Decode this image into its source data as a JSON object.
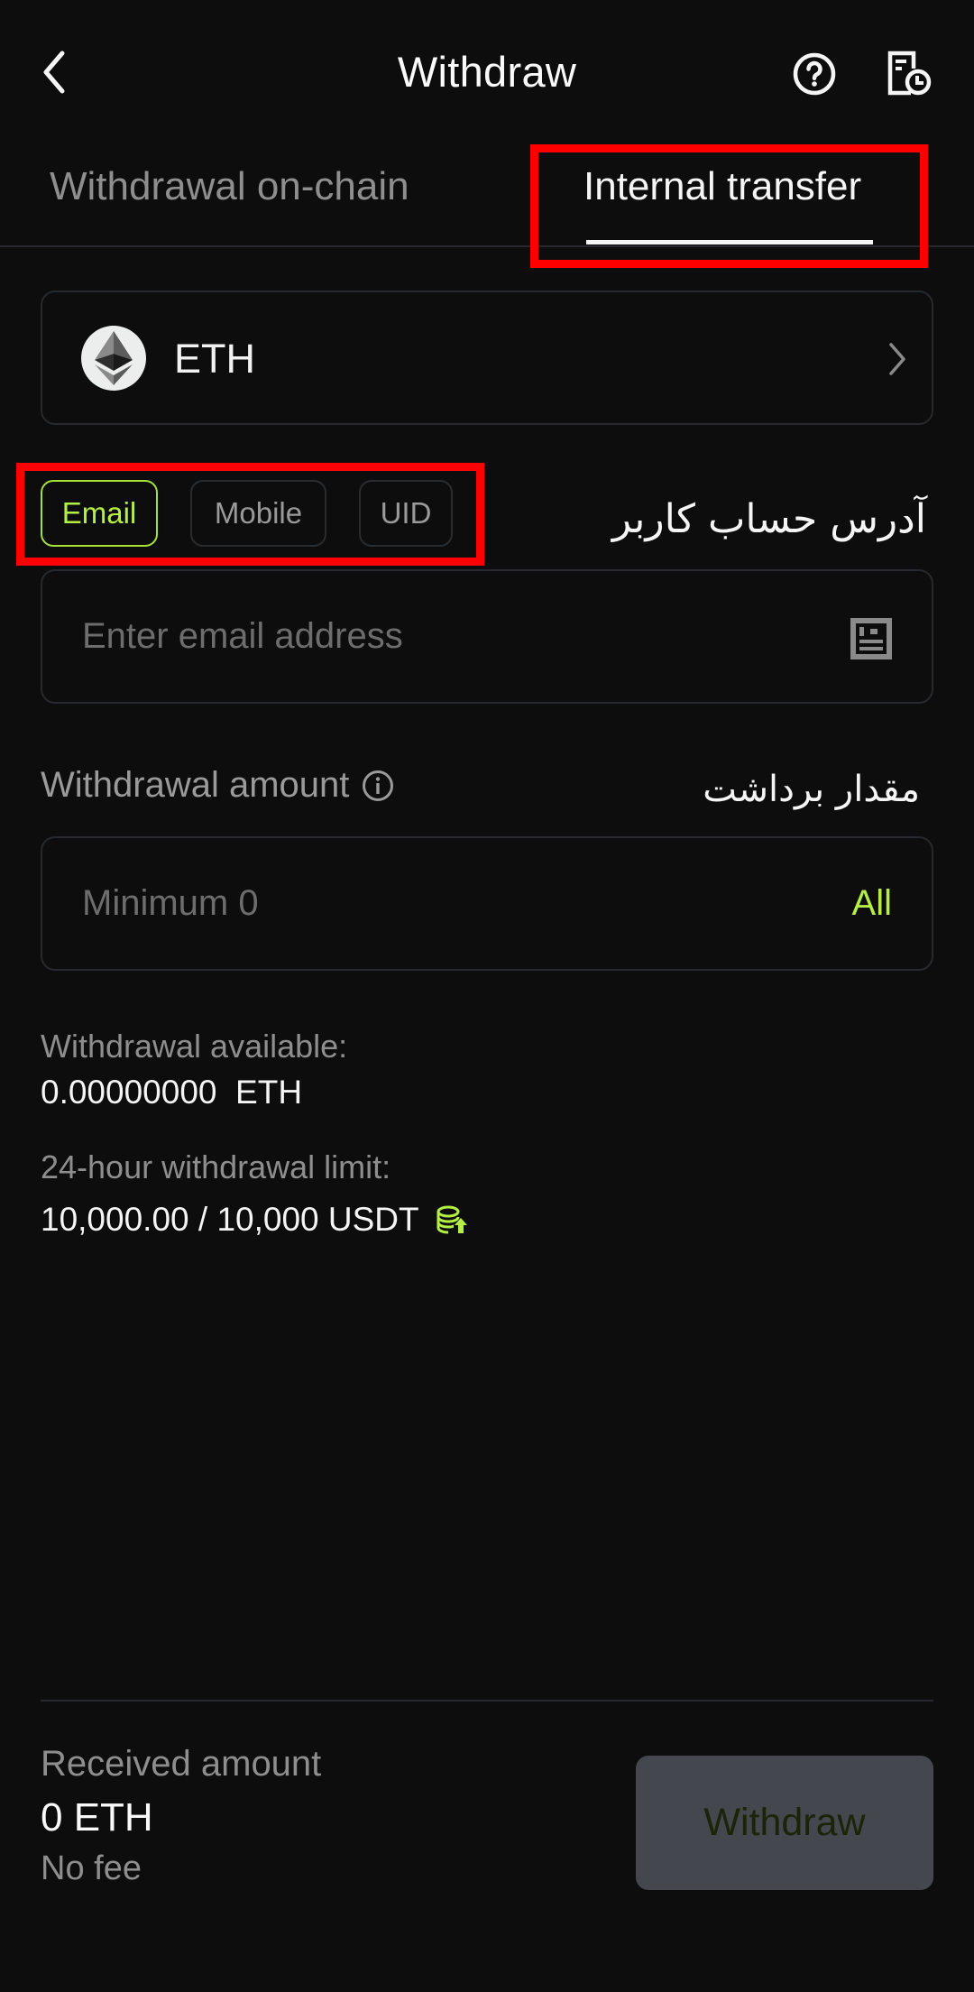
{
  "header": {
    "title": "Withdraw",
    "back_icon": "chevron-left-icon",
    "help_icon": "question-circle-icon",
    "history_icon": "document-clock-icon"
  },
  "tabs": [
    {
      "label": "Withdrawal on-chain",
      "active": false
    },
    {
      "label": "Internal transfer",
      "active": true
    }
  ],
  "asset": {
    "symbol": "ETH",
    "icon": "ethereum-icon",
    "chevron_icon": "chevron-right-icon"
  },
  "recipient": {
    "types": [
      {
        "label": "Email",
        "selected": true
      },
      {
        "label": "Mobile",
        "selected": false
      },
      {
        "label": "UID",
        "selected": false
      }
    ],
    "label_fa": "آدرس حساب کاربر",
    "input": {
      "value": "",
      "placeholder": "Enter email address"
    },
    "contacts_icon": "address-book-icon"
  },
  "amount": {
    "label": "Withdrawal amount",
    "info_icon": "info-icon",
    "label_fa": "مقدار برداشت",
    "input": {
      "value": "",
      "placeholder": "Minimum 0"
    },
    "all_label": "All"
  },
  "balance": {
    "available_label": "Withdrawal available:",
    "available_value": "0.00000000  ETH",
    "limit_label": "24-hour withdrawal limit:",
    "limit_value": "10,000.00 / 10,000 USDT",
    "limit_icon": "coins-upgrade-icon"
  },
  "footer": {
    "received_label": "Received amount",
    "received_value": "0 ETH",
    "fee_label": "No fee",
    "withdraw_label": "Withdraw"
  },
  "colors": {
    "accent": "#b6ef43",
    "background": "#0d0d0d",
    "annotation": "#ff0000",
    "button_disabled": "#44474d"
  }
}
